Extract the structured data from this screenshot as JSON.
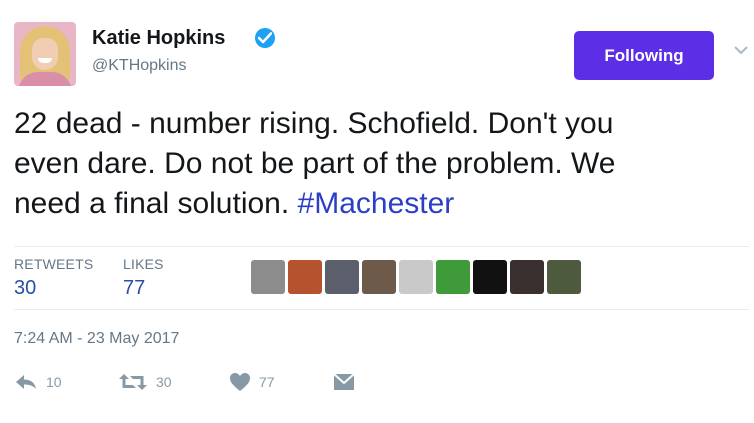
{
  "author": {
    "name": "Katie Hopkins",
    "handle": "@KTHopkins",
    "verified": true,
    "avatar_icon": "profile-photo"
  },
  "follow_button": {
    "label": "Following",
    "color": "#5c2ee6"
  },
  "tweet": {
    "text_lines": [
      "22 dead - number rising. Schofield. Don't you",
      "even dare. Do not be part of the problem. We",
      "need a final solution. "
    ],
    "hashtag": "#Machester",
    "hashtag_color": "#2b3fc5"
  },
  "stats": {
    "retweets_label": "RETWEETS",
    "retweets_value": "30",
    "likes_label": "LIKES",
    "likes_value": "77"
  },
  "likers": [
    {
      "icon": "liker-avatar-1",
      "color": "#8c8c8c"
    },
    {
      "icon": "liker-avatar-2",
      "color": "#b5532f"
    },
    {
      "icon": "liker-avatar-3",
      "color": "#5a5f6b"
    },
    {
      "icon": "liker-avatar-4",
      "color": "#6e5a4a"
    },
    {
      "icon": "liker-avatar-5",
      "color": "#c9c9c9"
    },
    {
      "icon": "liker-avatar-6",
      "color": "#3f9a3a"
    },
    {
      "icon": "liker-avatar-7",
      "color": "#111111"
    },
    {
      "icon": "liker-avatar-8",
      "color": "#3a2f2f"
    },
    {
      "icon": "liker-avatar-9",
      "color": "#4d5a3d"
    }
  ],
  "timestamp": "7:24 AM - 23 May 2017",
  "actions": {
    "reply_count": "10",
    "retweet_count": "30",
    "like_count": "77",
    "action_color": "#8899a6"
  }
}
